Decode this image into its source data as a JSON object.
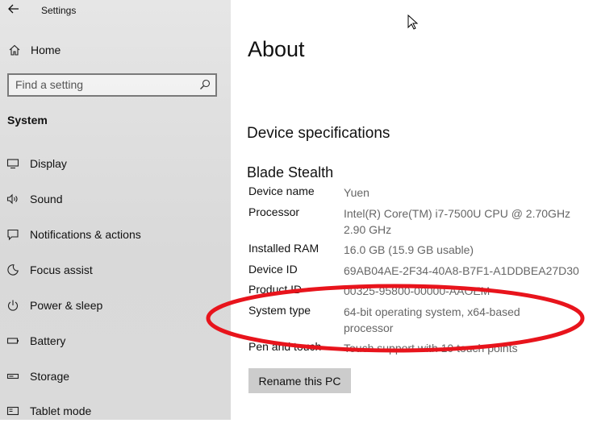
{
  "window": {
    "title": "Settings"
  },
  "sidebar": {
    "home_label": "Home",
    "search_placeholder": "Find a setting",
    "section_label": "System",
    "items": [
      {
        "label": "Display",
        "icon": "display-icon"
      },
      {
        "label": "Sound",
        "icon": "speaker-icon"
      },
      {
        "label": "Notifications & actions",
        "icon": "notification-icon"
      },
      {
        "label": "Focus assist",
        "icon": "moon-icon"
      },
      {
        "label": "Power & sleep",
        "icon": "power-icon"
      },
      {
        "label": "Battery",
        "icon": "battery-icon"
      },
      {
        "label": "Storage",
        "icon": "storage-icon"
      },
      {
        "label": "Tablet mode",
        "icon": "tablet-icon"
      }
    ]
  },
  "main": {
    "title": "About",
    "section_title": "Device specifications",
    "device_model": "Blade Stealth",
    "specs": [
      {
        "key": "Device name",
        "value": "Yuen"
      },
      {
        "key": "Processor",
        "value": "Intel(R) Core(TM) i7-7500U CPU @ 2.70GHz",
        "value2": "2.90 GHz"
      },
      {
        "key": "Installed RAM",
        "value": "16.0 GB (15.9 GB usable)"
      },
      {
        "key": "Device ID",
        "value": "69AB04AE-2F34-40A8-B7F1-A1DDBEA27D30"
      },
      {
        "key": "Product ID",
        "value": "00325-95800-00000-AAOEM"
      },
      {
        "key": "System type",
        "value": "64-bit operating system, x64-based",
        "value2": "processor"
      },
      {
        "key": "Pen and touch",
        "value": "Touch support with 10 touch points"
      }
    ],
    "rename_button": "Rename this PC"
  },
  "colors": {
    "annotation": "#e8141c",
    "sidebar_bg": "#dedede",
    "button_bg": "#cccccc"
  }
}
